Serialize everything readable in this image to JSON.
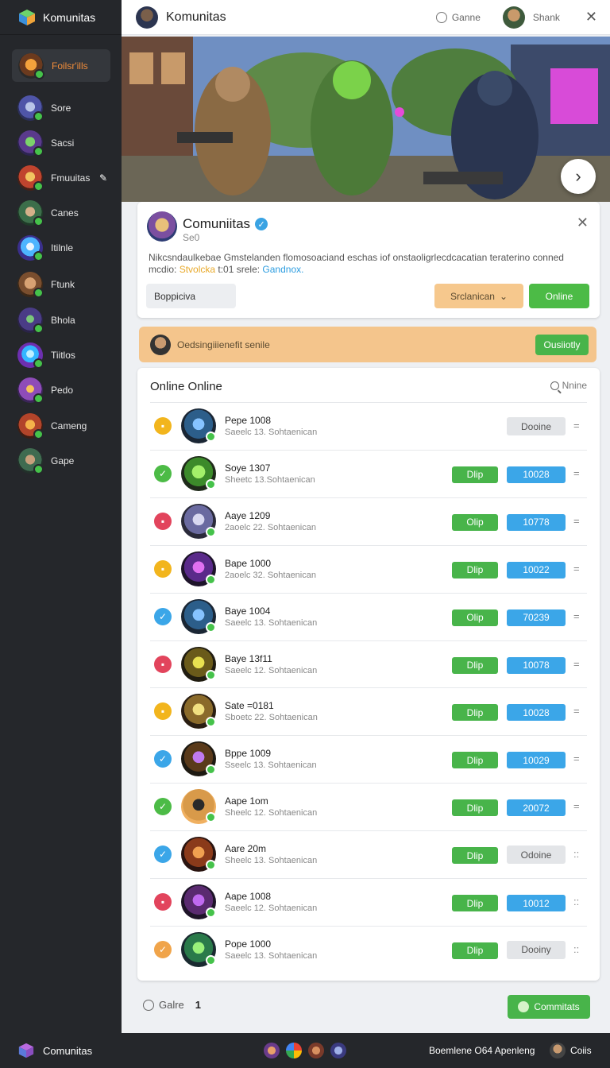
{
  "app": {
    "brand": "Komunitas",
    "title": "Komunitas"
  },
  "topbar": {
    "game_label": "Ganne",
    "user_name": "Shank"
  },
  "sidebar": {
    "active": {
      "label": "Foilsr'ills"
    },
    "items": [
      {
        "label": "Sore"
      },
      {
        "label": "Sacsi"
      },
      {
        "label": "Fmuuitas"
      },
      {
        "label": "Canes"
      },
      {
        "label": "Itilnle"
      },
      {
        "label": "Ftunk"
      },
      {
        "label": "Bhola"
      },
      {
        "label": "Tiitlos"
      },
      {
        "label": "Pedo"
      },
      {
        "label": "Cameng"
      },
      {
        "label": "Gape"
      }
    ]
  },
  "community": {
    "name": "Comuniitas",
    "sub": "Se0",
    "desc_main": "Nikcsndaulkebae Gmstelanden flomosoaciand eschas iof onstaoligrlecdcacatian teraterino conned",
    "desc_prefix": "mcdio: ",
    "desc_hl1": "Stvolcka",
    "desc_mid": " t:01 srele: ",
    "desc_hl2": "Gandnox.",
    "input_value": "Boppiciva",
    "select_label": "Srclanican",
    "online_button": "Online"
  },
  "notice": {
    "text": "Oedsingiiienefit senile",
    "button": "Ousiiotly"
  },
  "list": {
    "title": "Online Online",
    "search_label": "Nnine",
    "rows": [
      {
        "name": "Pepe 1008",
        "sub": "Saeelc 13. Sohtaenican",
        "status": "yellow",
        "green": "",
        "blue": "",
        "gray": "Dooine",
        "menu": "="
      },
      {
        "name": "Soye 1307",
        "sub": "Sheetc 13.Sohtaenican",
        "status": "green",
        "green": "Dlip",
        "blue": "10028",
        "gray": "",
        "menu": "="
      },
      {
        "name": "Aaye 1209",
        "sub": "2aoelc 22. Sohtaenican",
        "status": "red",
        "green": "Olip",
        "blue": "10778",
        "gray": "",
        "menu": "="
      },
      {
        "name": "Bape 1000",
        "sub": "2aoelc 32. Sohtaenican",
        "status": "yellow",
        "green": "Dlip",
        "blue": "10022",
        "gray": "",
        "menu": "="
      },
      {
        "name": "Baye 1004",
        "sub": "Saeelc 13. Sohtaenican",
        "status": "blue",
        "green": "Olip",
        "blue": "70239",
        "gray": "",
        "menu": "="
      },
      {
        "name": "Baye 13f11",
        "sub": "Saeelc 12. Sohtaenican",
        "status": "red",
        "green": "Dlip",
        "blue": "10078",
        "gray": "",
        "menu": "="
      },
      {
        "name": "Sate =0181",
        "sub": "Sboetc 22. Sohtaenican",
        "status": "yellow",
        "green": "Dlip",
        "blue": "10028",
        "gray": "",
        "menu": "="
      },
      {
        "name": "Bppe 1009",
        "sub": "Sseelc 13. Sohtaenican",
        "status": "blue",
        "green": "Dlip",
        "blue": "10029",
        "gray": "",
        "menu": "="
      },
      {
        "name": "Aape 1om",
        "sub": "Sheelc 12. Sohtaenican",
        "status": "green",
        "green": "Dlip",
        "blue": "20072",
        "gray": "",
        "menu": "="
      },
      {
        "name": "Aare 20m",
        "sub": "Sheelc 13. Sohtaenican",
        "status": "blue",
        "green": "Dlip",
        "blue": "",
        "gray": "Odoine",
        "menu": "::"
      },
      {
        "name": "Aape 1008",
        "sub": "Saeelc 12. Sohtaenican",
        "status": "red",
        "green": "Dlip",
        "blue": "10012",
        "gray": "",
        "menu": "::"
      },
      {
        "name": "Pope 1000",
        "sub": "Saeelc 13. Sohtaenican",
        "status": "orange",
        "green": "Dlip",
        "blue": "",
        "gray": "Dooiny",
        "menu": "::"
      }
    ]
  },
  "footer": {
    "pager_label": "Galre",
    "page": "1",
    "cta": "Commitats"
  },
  "bottombar": {
    "brand": "Comunitas",
    "text": "Boemlene O64 Apenleng",
    "user": "Coiis"
  },
  "colors": {
    "accent_green": "#48b44a",
    "accent_blue": "#3ba6e8",
    "accent_orange": "#f08c3a",
    "sidebar_bg": "#25272b"
  }
}
